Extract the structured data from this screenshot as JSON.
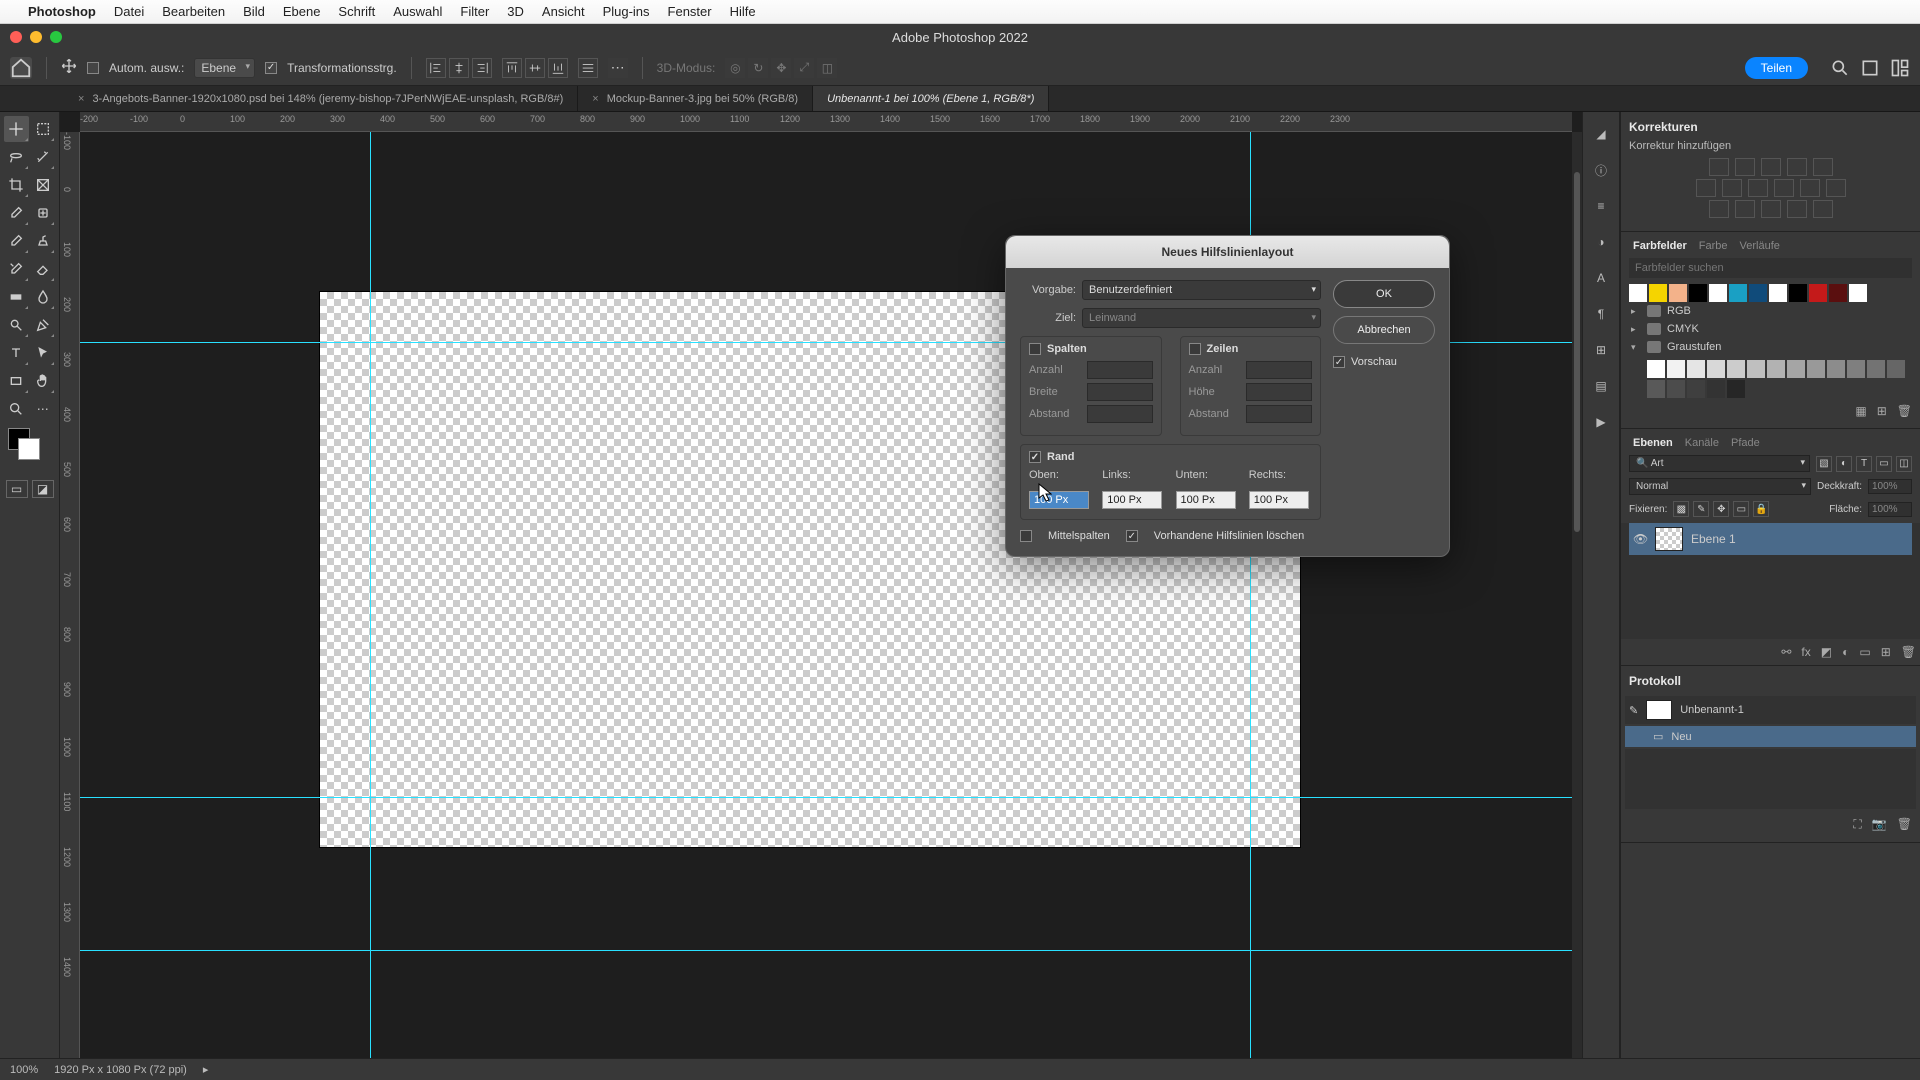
{
  "mac_menu": {
    "app": "Photoshop",
    "items": [
      "Datei",
      "Bearbeiten",
      "Bild",
      "Ebene",
      "Schrift",
      "Auswahl",
      "Filter",
      "3D",
      "Ansicht",
      "Plug-ins",
      "Fenster",
      "Hilfe"
    ]
  },
  "window_title": "Adobe Photoshop 2022",
  "options": {
    "auto_select": "Autom. ausw.:",
    "target": "Ebene",
    "transform_ctrls": "Transformationsstrg.",
    "three_d_mode": "3D-Modus:",
    "share": "Teilen"
  },
  "tabs": [
    {
      "label": "3-Angebots-Banner-1920x1080.psd bei 148% (jeremy-bishop-7JPerNWjEAE-unsplash, RGB/8#)",
      "active": false
    },
    {
      "label": "Mockup-Banner-3.jpg bei 50% (RGB/8)",
      "active": false
    },
    {
      "label": "Unbenannt-1 bei 100% (Ebene 1, RGB/8*)",
      "active": true
    }
  ],
  "ruler_h_ticks": [
    "-200",
    "-100",
    "0",
    "100",
    "200",
    "300",
    "400",
    "500",
    "600",
    "700",
    "800",
    "900",
    "1000",
    "1100",
    "1200",
    "1300",
    "1400",
    "1500",
    "1600",
    "1700",
    "1800",
    "1900",
    "2000",
    "2100",
    "2200",
    "2300"
  ],
  "ruler_v_ticks": [
    "-100",
    "0",
    "100",
    "200",
    "300",
    "400",
    "500",
    "600",
    "700",
    "800",
    "900",
    "1000",
    "1100",
    "1200",
    "1300",
    "1400"
  ],
  "dialog": {
    "title": "Neues Hilfslinienlayout",
    "preset_label": "Vorgabe:",
    "preset_value": "Benutzerdefiniert",
    "target_label": "Ziel:",
    "target_value": "Leinwand",
    "columns_label": "Spalten",
    "rows_label": "Zeilen",
    "count_label": "Anzahl",
    "width_label": "Breite",
    "height_label": "Höhe",
    "gutter_label": "Abstand",
    "margin_label": "Rand",
    "top": "Oben:",
    "left": "Links:",
    "bottom": "Unten:",
    "right": "Rechts:",
    "m_top": "100 Px",
    "m_left": "100 Px",
    "m_bottom": "100 Px",
    "m_right": "100 Px",
    "center_cols": "Mittelspalten",
    "clear_existing": "Vorhandene Hilfslinien löschen",
    "ok": "OK",
    "cancel": "Abbrechen",
    "preview": "Vorschau"
  },
  "right_panels": {
    "adjustments_title": "Korrekturen",
    "add_adjustment": "Korrektur hinzufügen",
    "swatches_tabs": [
      "Farbfelder",
      "Farbe",
      "Verläufe"
    ],
    "swatch_search_ph": "Farbfelder suchen",
    "swatch_folders": [
      "RGB",
      "CMYK",
      "Graustufen"
    ],
    "layers_tabs": [
      "Ebenen",
      "Kanäle",
      "Pfade"
    ],
    "layers_filter_ph": "Art",
    "blend_mode": "Normal",
    "opacity_label": "Deckkraft:",
    "opacity_val": "100%",
    "lock_label": "Fixieren:",
    "fill_label": "Fläche:",
    "fill_val": "100%",
    "layer1": "Ebene 1",
    "history_title": "Protokoll",
    "history_doc": "Unbenannt-1",
    "history_step": "Neu"
  },
  "status": {
    "zoom": "100%",
    "docinfo": "1920 Px x 1080 Px (72 ppi)"
  },
  "swatch_colors": [
    "#ffffff",
    "#f5d400",
    "#f3b28a",
    "#000000",
    "#ffffff",
    "#1aa0c4",
    "#104b7a",
    "#ffffff",
    "#000000",
    "#c41a1a",
    "#5a0f0f",
    "#ffffff"
  ],
  "gray_swatches": [
    "#ffffff",
    "#f2f2f2",
    "#e5e5e5",
    "#d8d8d8",
    "#cccccc",
    "#bfbfbf",
    "#b2b2b2",
    "#a5a5a5",
    "#999999",
    "#8c8c8c",
    "#7f7f7f",
    "#737373",
    "#666666",
    "#595959",
    "#4c4c4c",
    "#3f3f3f",
    "#333333",
    "#262626"
  ]
}
